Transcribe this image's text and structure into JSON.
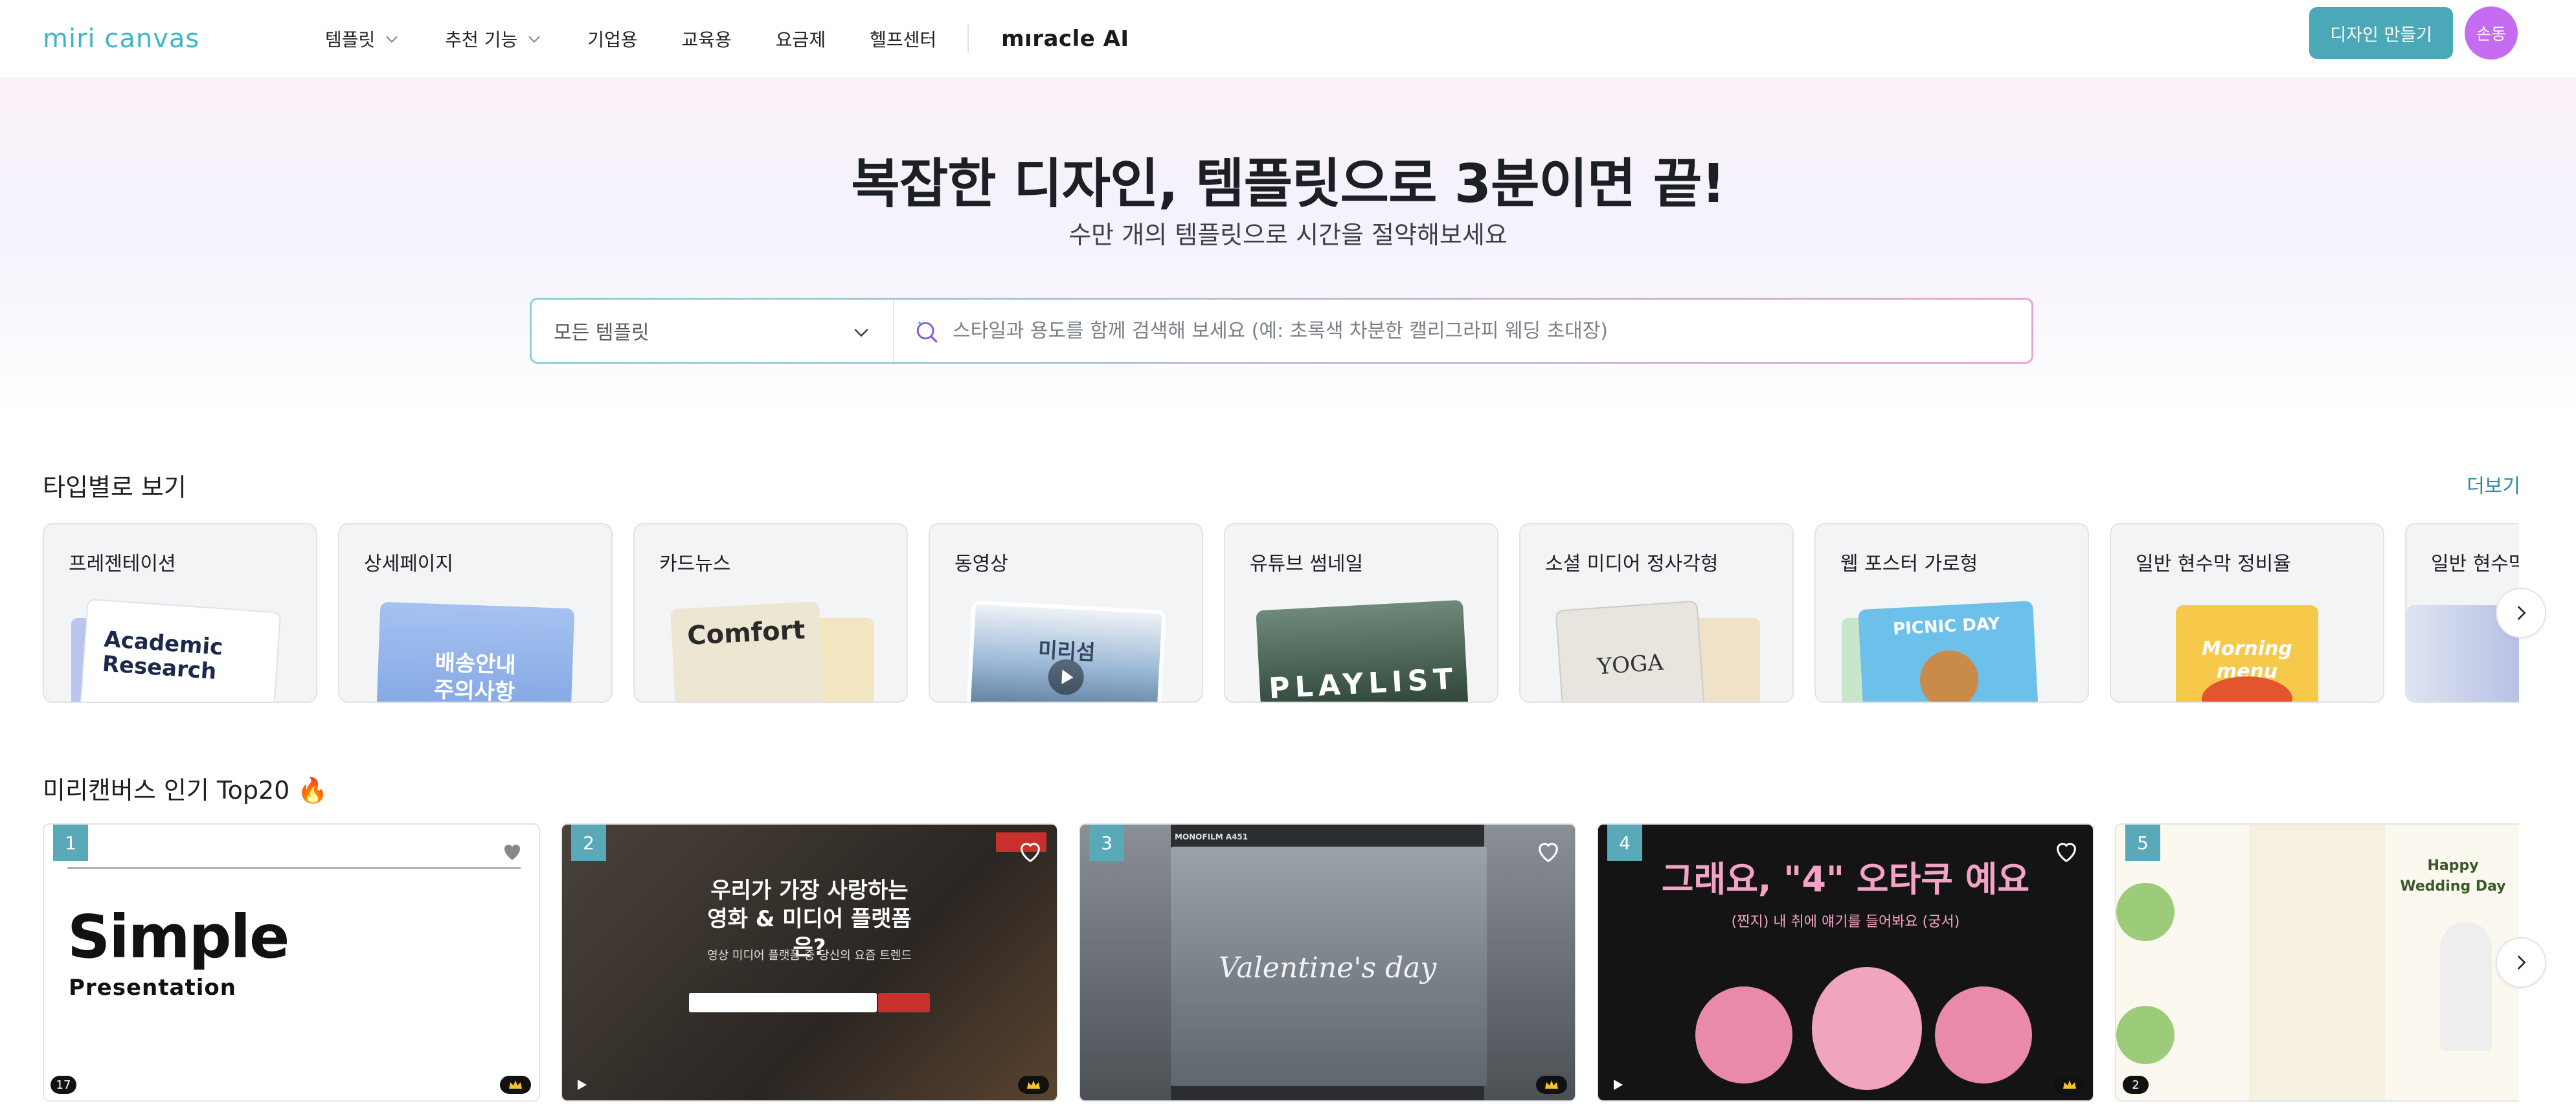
{
  "header": {
    "logo": "miri canvas",
    "nav": [
      {
        "label": "템플릿",
        "dropdown": true
      },
      {
        "label": "추천 기능",
        "dropdown": true
      },
      {
        "label": "기업용",
        "dropdown": false
      },
      {
        "label": "교육용",
        "dropdown": false
      },
      {
        "label": "요금제",
        "dropdown": false
      },
      {
        "label": "헬프센터",
        "dropdown": false
      }
    ],
    "miracle_ai": "mıracle AI",
    "design_button": "디자인 만들기",
    "avatar": "손동"
  },
  "hero": {
    "title": "복잡한 디자인, 템플릿으로 3분이면 끝!",
    "subtitle": "수만 개의 템플릿으로 시간을 절약해보세요",
    "select_value": "모든 템플릿",
    "search_placeholder": "스타일과 용도를 함께 검색해 보세요 (예: 초록색 차분한 캘리그라피 웨딩 초대장)"
  },
  "types": {
    "title": "타입별로 보기",
    "more": "더보기",
    "items": [
      {
        "label": "프레젠테이션",
        "thumb_text": "Academic Research",
        "bg": "#ffffff",
        "fg": "#1b2a4a"
      },
      {
        "label": "상세페이지",
        "thumb_text": "배송안내 주의사항",
        "bg": "#8fb4ea",
        "fg": "#ffffff"
      },
      {
        "label": "카드뉴스",
        "thumb_text": "Comfort",
        "bg": "#e9e3cf",
        "fg": "#2a2a2a"
      },
      {
        "label": "동영상",
        "thumb_text": "미리섬",
        "bg": "#7da4c8",
        "fg": "#ffffff"
      },
      {
        "label": "유튜브 썸네일",
        "thumb_text": "PLAYLIST",
        "bg": "#2e4a3a",
        "fg": "#ffffff"
      },
      {
        "label": "소셜 미디어 정사각형",
        "thumb_text": "YOGA",
        "bg": "#e6e2dc",
        "fg": "#333333"
      },
      {
        "label": "웹 포스터 가로형",
        "thumb_text": "PICNIC DAY",
        "bg": "#6fc0e8",
        "fg": "#ffffff"
      },
      {
        "label": "일반 현수막 정비율",
        "thumb_text": "Morning menu",
        "bg": "#f6c94a",
        "fg": "#ffffff"
      },
      {
        "label": "일반 현수막",
        "thumb_text": "",
        "bg": "#c9d2ea",
        "fg": "#ffffff"
      }
    ]
  },
  "top20": {
    "title": "미리캔버스 인기 Top20 🔥",
    "items": [
      {
        "rank": "1",
        "bg": "#ffffff",
        "count": "17",
        "title": "Simple",
        "sub": "Presentation",
        "video": false
      },
      {
        "rank": "2",
        "bg": "#3a3430",
        "count": "",
        "title": "우리가 가장 사랑하는 영화 & 미디어 플랫폼은?",
        "sub": "영상 미디어 플랫폼 중 당신의 요즘 트렌드",
        "video": true
      },
      {
        "rank": "3",
        "bg": "#6d7278",
        "count": "",
        "title": "Valentine's day",
        "sub": "MONOFILM A451",
        "video": true
      },
      {
        "rank": "4",
        "bg": "#151515",
        "count": "",
        "title": "그래요, \"4\" 오타쿠 예요",
        "sub": "(찐지) 내 취에 얘기를 들어봐요 (궁서)",
        "video": true
      },
      {
        "rank": "5",
        "bg": "#fbf8f0",
        "count": "2",
        "title": "Happy Wedding Day",
        "sub": "",
        "video": false
      }
    ]
  },
  "colors": {
    "accent": "#4aa8b8",
    "logo": "#3bb8c3",
    "avatar": "#c56cf0",
    "link": "#2a8aa0"
  }
}
